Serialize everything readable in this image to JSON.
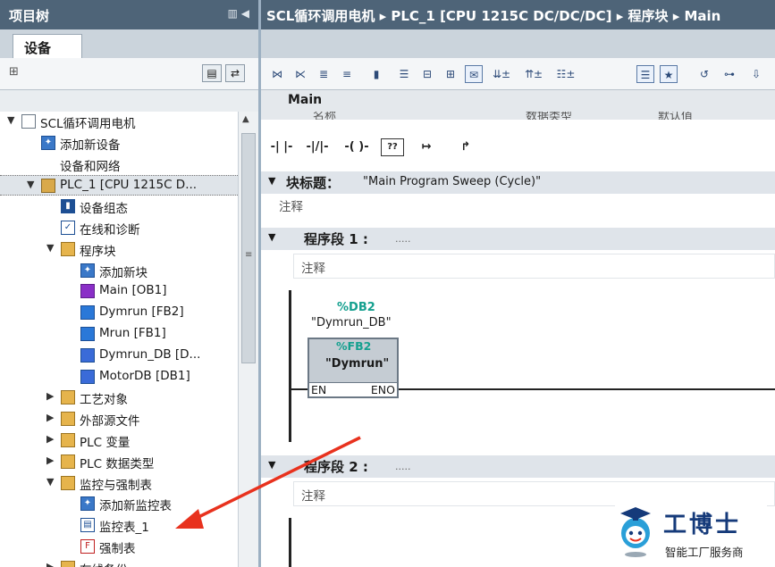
{
  "left_panel": {
    "title": "项目树",
    "tab": "设备"
  },
  "tree": [
    {
      "label": "SCL循环调用电机",
      "arrow": "▼",
      "icon": "project-icon"
    },
    {
      "label": "添加新设备",
      "arrow": "",
      "icon": "add-device-icon"
    },
    {
      "label": "设备和网络",
      "arrow": "",
      "icon": "network-icon"
    },
    {
      "label": "PLC_1 [CPU 1215C D...",
      "arrow": "▼",
      "icon": "plc-icon"
    },
    {
      "label": "设备组态",
      "arrow": "",
      "icon": "device-config-icon"
    },
    {
      "label": "在线和诊断",
      "arrow": "",
      "icon": "online-diag-icon"
    },
    {
      "label": "程序块",
      "arrow": "▼",
      "icon": "folder-icon"
    },
    {
      "label": "添加新块",
      "arrow": "",
      "icon": "add-block-icon"
    },
    {
      "label": "Main [OB1]",
      "arrow": "",
      "icon": "ob-icon"
    },
    {
      "label": "Dymrun [FB2]",
      "arrow": "",
      "icon": "fb-icon"
    },
    {
      "label": "Mrun [FB1]",
      "arrow": "",
      "icon": "fb-icon"
    },
    {
      "label": "Dymrun_DB [D...",
      "arrow": "",
      "icon": "db-icon"
    },
    {
      "label": "MotorDB [DB1]",
      "arrow": "",
      "icon": "db-icon"
    },
    {
      "label": "工艺对象",
      "arrow": "▶",
      "icon": "folder-icon"
    },
    {
      "label": "外部源文件",
      "arrow": "▶",
      "icon": "folder-icon"
    },
    {
      "label": "PLC 变量",
      "arrow": "▶",
      "icon": "folder-icon"
    },
    {
      "label": "PLC 数据类型",
      "arrow": "▶",
      "icon": "folder-icon"
    },
    {
      "label": "监控与强制表",
      "arrow": "▼",
      "icon": "folder-icon"
    },
    {
      "label": "添加新监控表",
      "arrow": "",
      "icon": "add-watch-icon"
    },
    {
      "label": "监控表_1",
      "arrow": "",
      "icon": "watch-table-icon"
    },
    {
      "label": "强制表",
      "arrow": "",
      "icon": "force-table-icon"
    },
    {
      "label": "在线备份",
      "arrow": "▶",
      "icon": "folder-icon"
    }
  ],
  "breadcrumb": {
    "text": "SCL循环调用电机 ▸ PLC_1 [CPU 1215C DC/DC/DC] ▸ 程序块 ▸ Main"
  },
  "editor": {
    "block_name": "Main",
    "columns": [
      "名称",
      "数据类型",
      "默认值"
    ],
    "block_title_label": "块标题：",
    "block_title_value": "\"Main Program Sweep (Cycle)\"",
    "block_comment": "注释"
  },
  "instructions": [
    "-| |-",
    "-|/|-",
    "-( )-",
    "??",
    "↦",
    "↱"
  ],
  "networks": [
    {
      "label": "程序段 1 :",
      "dots": ".....",
      "comment": "注释"
    },
    {
      "label": "程序段 2 :",
      "dots": ".....",
      "comment": "注释"
    }
  ],
  "fb_call": {
    "db_address": "%DB2",
    "db_name": "\"Dymrun_DB\"",
    "fb_address": "%FB2",
    "fb_name": "\"Dymrun\"",
    "pin_en": "EN",
    "pin_eno": "ENO"
  },
  "watermark": {
    "name": "工博士",
    "subtitle": "智能工厂服务商"
  },
  "colors": {
    "title_bar": "#4e6478",
    "annotation_arrow": "#e8321e",
    "address_teal": "#15a08f"
  }
}
